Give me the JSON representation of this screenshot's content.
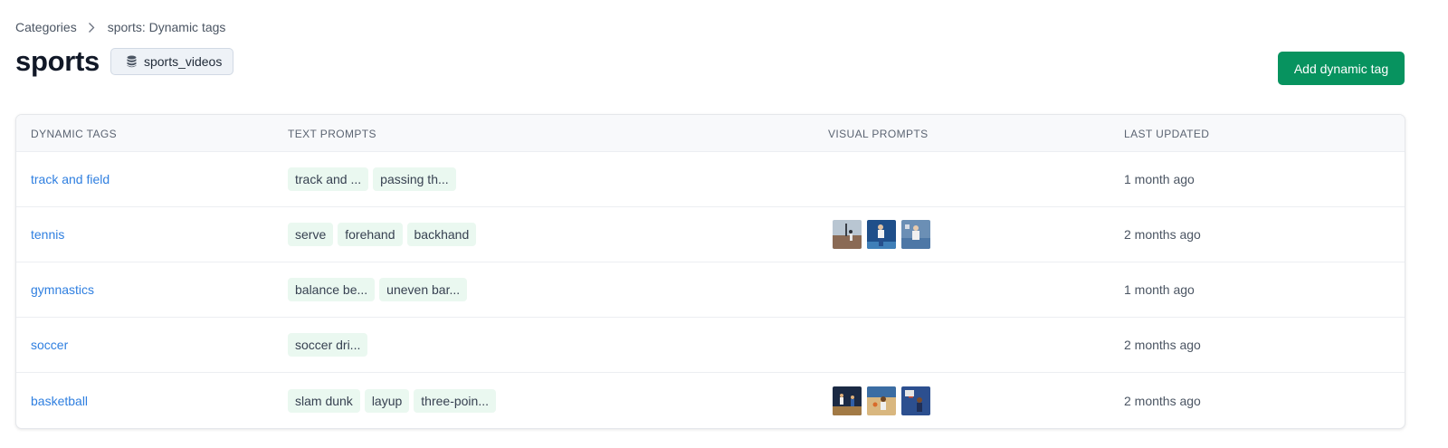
{
  "breadcrumb": {
    "root": "Categories",
    "current": "sports: Dynamic tags"
  },
  "header": {
    "title": "sports",
    "dataset": "sports_videos",
    "add_button": "Add dynamic tag"
  },
  "table": {
    "columns": [
      "DYNAMIC TAGS",
      "TEXT PROMPTS",
      "VISUAL PROMPTS",
      "LAST UPDATED"
    ],
    "rows": [
      {
        "tag": "track and field",
        "prompts": [
          "track and ...",
          "passing th..."
        ],
        "thumbs": [],
        "updated": "1 month ago"
      },
      {
        "tag": "tennis",
        "prompts": [
          "serve",
          "forehand",
          "backhand"
        ],
        "thumbs": [
          "tennis-image-1",
          "tennis-image-2",
          "tennis-image-3"
        ],
        "updated": "2 months ago"
      },
      {
        "tag": "gymnastics",
        "prompts": [
          "balance be...",
          "uneven bar..."
        ],
        "thumbs": [],
        "updated": "1 month ago"
      },
      {
        "tag": "soccer",
        "prompts": [
          "soccer dri..."
        ],
        "thumbs": [],
        "updated": "2 months ago"
      },
      {
        "tag": "basketball",
        "prompts": [
          "slam dunk",
          "layup",
          "three-poin..."
        ],
        "thumbs": [
          "basketball-image-1",
          "basketball-image-2",
          "basketball-image-3"
        ],
        "updated": "2 months ago"
      }
    ]
  },
  "icons": {
    "separator": "chevron-right-icon",
    "dataset": "database-icon"
  },
  "colors": {
    "accent": "#07935f",
    "link": "#2f7fe0",
    "chip_bg": "#eaf8f0",
    "dataset_chip_bg": "#eef2f7"
  }
}
